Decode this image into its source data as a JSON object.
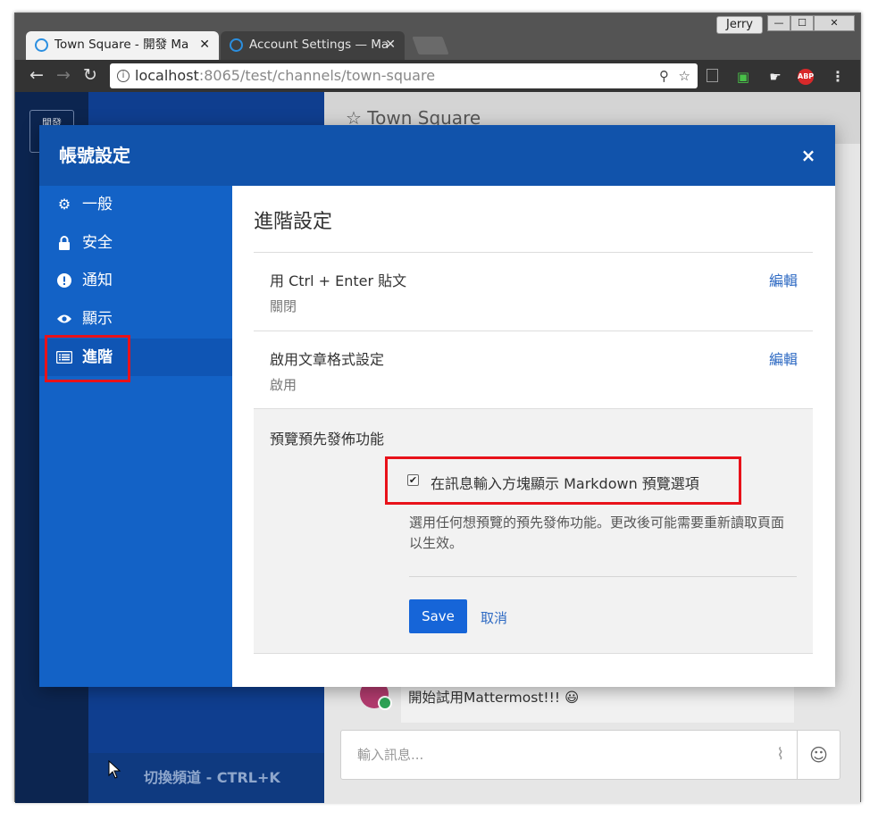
{
  "browser": {
    "user_name": "Jerry",
    "tabs": [
      {
        "label": "Town Square - 開發 Ma"
      },
      {
        "label": "Account Settings — Ma"
      }
    ],
    "url_host": "localhost",
    "url_path": ":8065/test/channels/town-square",
    "extensions": [
      "copy-icon",
      "plugin-icon",
      "hand-icon",
      "ABP",
      "menu-icon"
    ]
  },
  "app": {
    "team_label": "開發",
    "channel_team_name": "開發",
    "channel_title": "Town Square",
    "switch_channel_label": "切換頻道 - CTRL+K",
    "post_text": "開始試用Mattermost!!! 😃",
    "message_placeholder": "輸入訊息..."
  },
  "modal": {
    "title": "帳號設定",
    "close_symbol": "×",
    "nav": [
      {
        "label": "一般",
        "icon": "gear-icon"
      },
      {
        "label": "安全",
        "icon": "lock-icon"
      },
      {
        "label": "通知",
        "icon": "exclamation-icon"
      },
      {
        "label": "顯示",
        "icon": "eye-icon"
      },
      {
        "label": "進階",
        "icon": "list-icon",
        "active": true
      }
    ],
    "section_title": "進階設定",
    "settings": [
      {
        "label": "用 Ctrl + Enter 貼文",
        "value": "關閉",
        "edit": "編輯"
      },
      {
        "label": "啟用文章格式設定",
        "value": "啟用",
        "edit": "編輯"
      }
    ],
    "preview_features": {
      "title": "預覽預先發佈功能",
      "checkbox_label": "在訊息輸入方塊顯示 Markdown 預覽選項",
      "checked": true,
      "help": "選用任何想預覽的預先發佈功能。更改後可能需要重新讀取頁面以生效。",
      "save_label": "Save",
      "cancel_label": "取消"
    }
  },
  "colors": {
    "modal_header": "#1153ab",
    "modal_nav": "#1362c6",
    "highlight": "#e8121a",
    "link": "#2e6ac3",
    "primary_button": "#1665d8"
  }
}
